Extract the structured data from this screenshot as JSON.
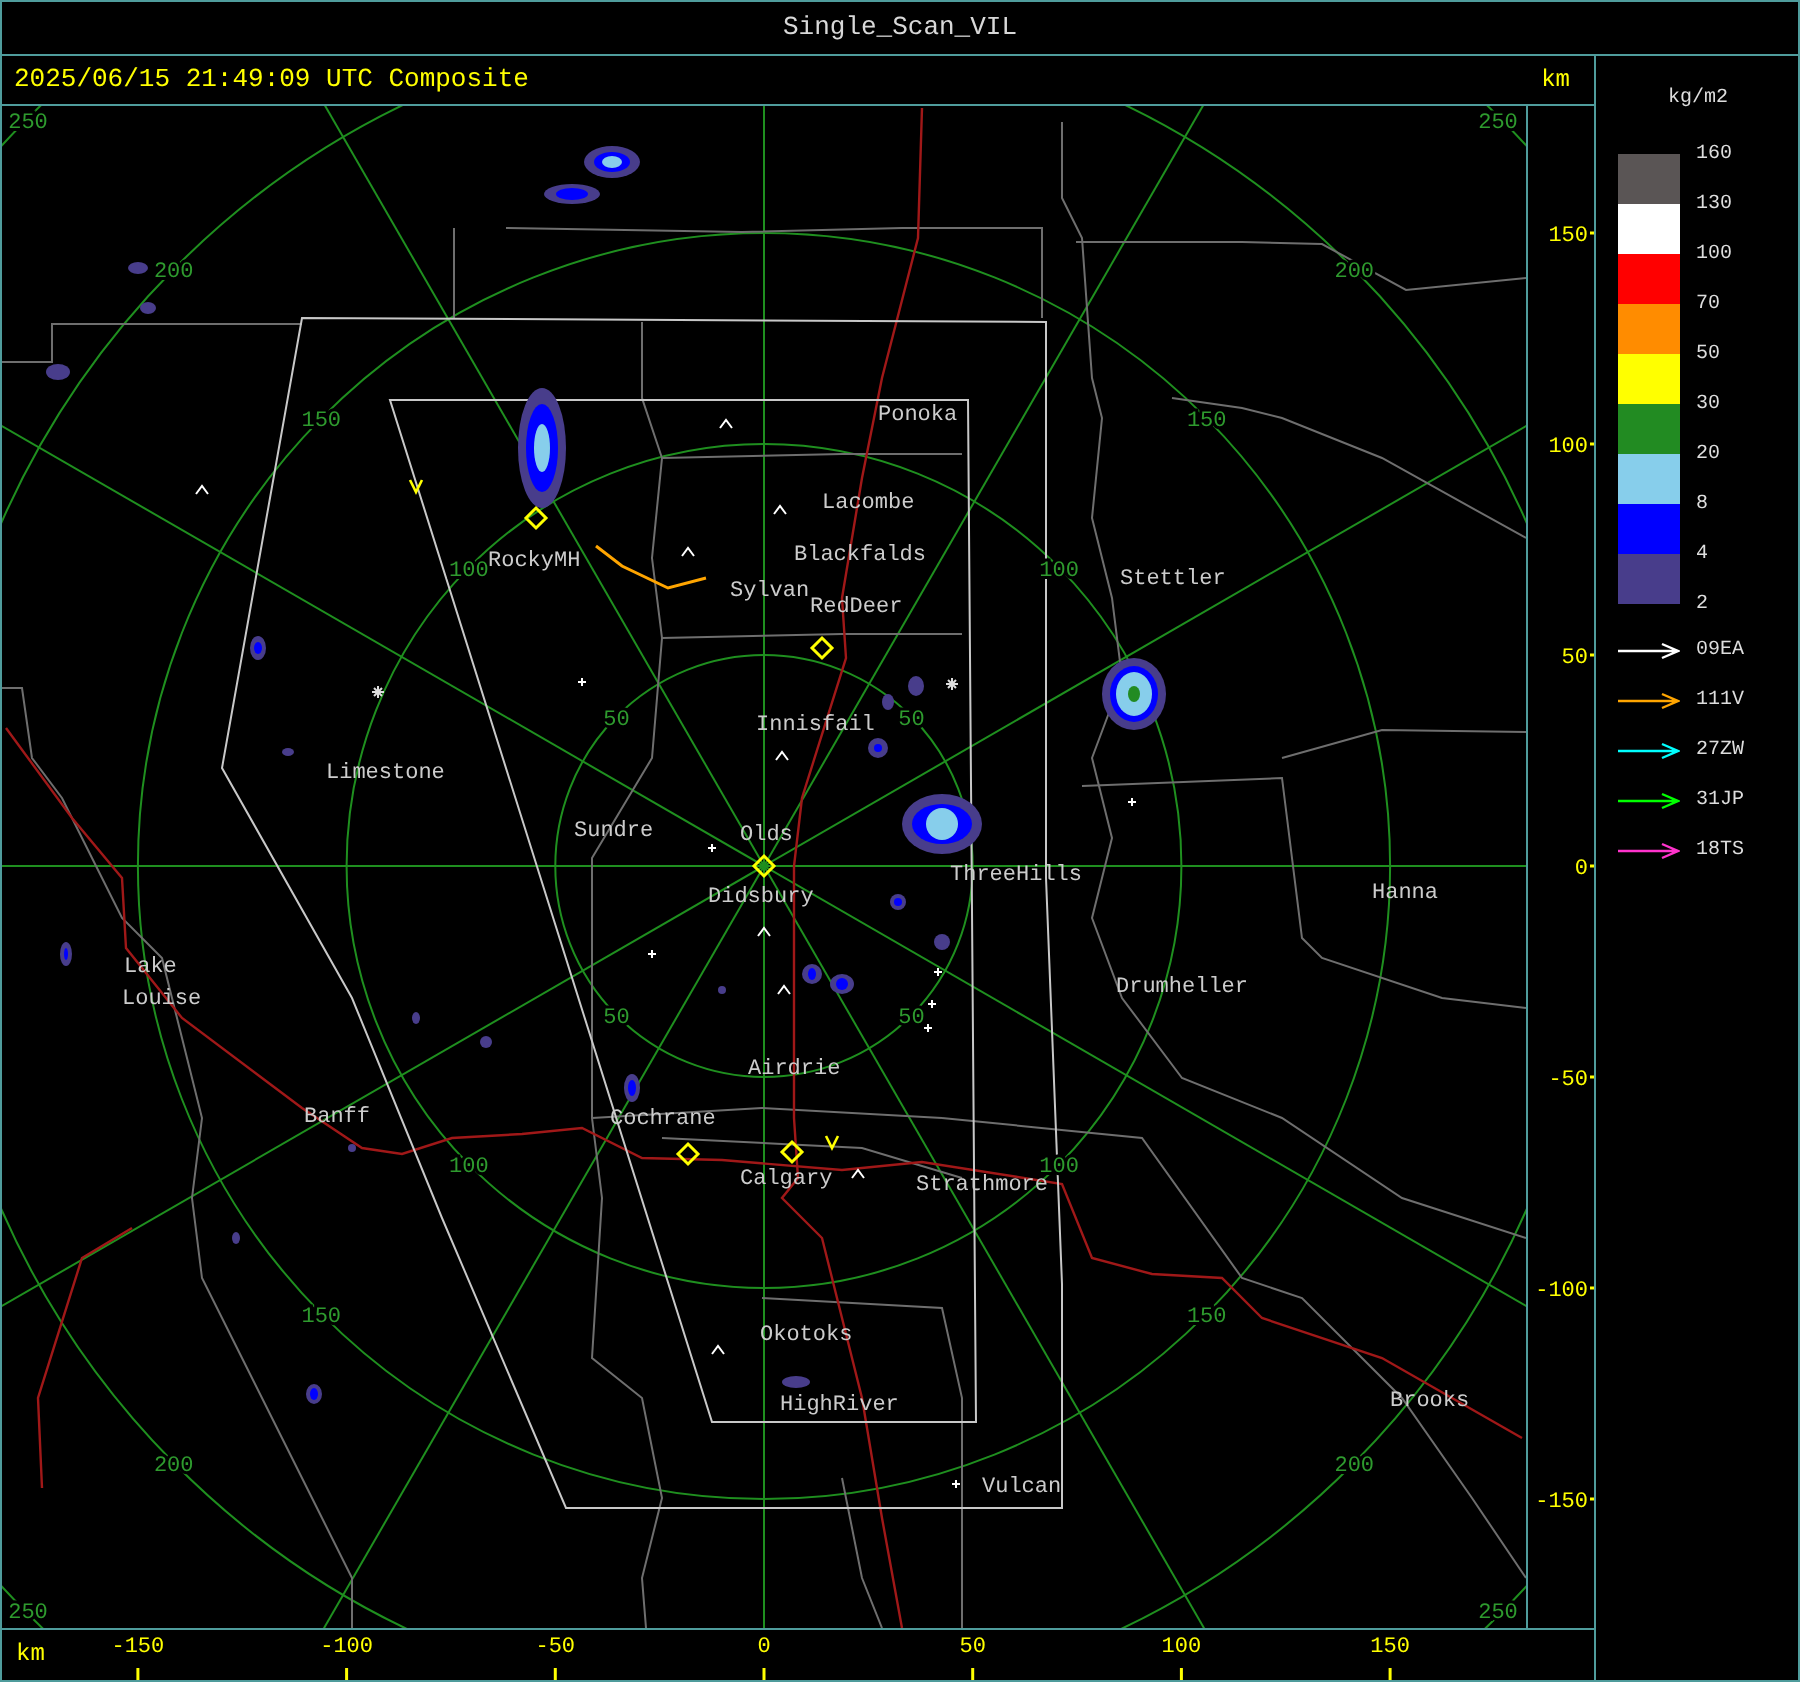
{
  "window": {
    "title": "Single_Scan_VIL"
  },
  "header": {
    "timestamp": "2025/06/15 21:49:09 UTC Composite",
    "unit": "km"
  },
  "map": {
    "range_rings": [
      {
        "labels": [
          "50",
          "50",
          "50",
          "50"
        ]
      },
      {
        "labels": [
          "100",
          "100",
          "100",
          "100"
        ]
      },
      {
        "labels": [
          "150",
          "150",
          "150",
          "150"
        ]
      },
      {
        "labels": [
          "200",
          "200",
          "200",
          "200"
        ]
      },
      {
        "labels": [
          "250",
          "250",
          "250",
          "250"
        ]
      }
    ],
    "towns": [
      "Ponoka",
      "Lacombe",
      "Blackfalds",
      "RockyMH",
      "Stettler",
      "Sylvan",
      "RedDeer",
      "Innisfail",
      "Limestone",
      "Sundre",
      "Olds",
      "ThreeHills",
      "Hanna",
      "Didsbury",
      "Lake",
      "Drumheller",
      "Louise",
      "Airdrie",
      "Banff",
      "Cochrane",
      "Calgary",
      "Strathmore",
      "Okotoks",
      "Brooks",
      "HighRiver",
      "Vulcan"
    ]
  },
  "y_axis": {
    "ticks": [
      "150",
      "100",
      "50",
      "0",
      "-50",
      "-100",
      "-150"
    ]
  },
  "x_axis": {
    "unit": "km",
    "ticks": [
      "-150",
      "-100",
      "-50",
      "0",
      "50",
      "100",
      "150"
    ]
  },
  "legend": {
    "unit": "kg/m2",
    "bins": [
      {
        "color": "#5a5555"
      },
      {
        "color": "#ffffff"
      },
      {
        "color": "#ff0000"
      },
      {
        "color": "#ff8c00"
      },
      {
        "color": "#ffff00"
      },
      {
        "color": "#228b22"
      },
      {
        "color": "#87ceeb"
      },
      {
        "color": "#0000ff"
      },
      {
        "color": "#483d8b"
      }
    ],
    "labels": [
      "160",
      "130",
      "100",
      "70",
      "50",
      "30",
      "20",
      "8",
      "4",
      "2"
    ]
  },
  "tracks": [
    {
      "name": "09EA",
      "color": "#ffffff"
    },
    {
      "name": "111V",
      "color": "#ffa500"
    },
    {
      "name": "27ZW",
      "color": "#00ffff"
    },
    {
      "name": "31JP",
      "color": "#00ff00"
    },
    {
      "name": "18TS",
      "color": "#ff33cc"
    }
  ]
}
